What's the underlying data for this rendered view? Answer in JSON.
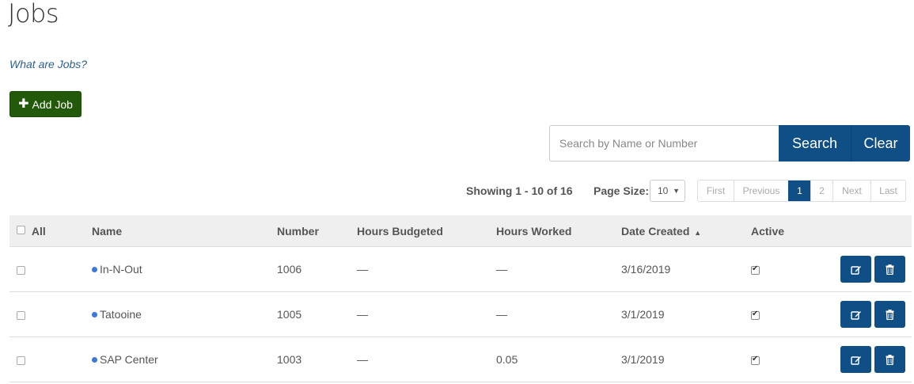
{
  "page": {
    "title": "Jobs",
    "help_link": "What are Jobs?"
  },
  "toolbar": {
    "add_label": "Add Job"
  },
  "search": {
    "placeholder": "Search by Name or Number",
    "value": "",
    "search_label": "Search",
    "clear_label": "Clear"
  },
  "paging": {
    "showing": "Showing 1 - 10 of 16",
    "page_size_label": "Page Size:",
    "page_size": "10",
    "first": "First",
    "previous": "Previous",
    "page_1": "1",
    "page_2": "2",
    "next": "Next",
    "last": "Last",
    "current_page": 1
  },
  "table": {
    "headers": {
      "all": "All",
      "name": "Name",
      "number": "Number",
      "hours_budgeted": "Hours Budgeted",
      "hours_worked": "Hours Worked",
      "date_created": "Date Created",
      "active": "Active"
    },
    "sort": {
      "column": "Date Created",
      "direction": "ascending"
    },
    "rows": [
      {
        "name": "In-N-Out",
        "number": "1006",
        "hours_budgeted": "—",
        "hours_worked": "—",
        "date_created": "3/16/2019",
        "active": true
      },
      {
        "name": "Tatooine",
        "number": "1005",
        "hours_budgeted": "—",
        "hours_worked": "—",
        "date_created": "3/1/2019",
        "active": true
      },
      {
        "name": "SAP Center",
        "number": "1003",
        "hours_budgeted": "—",
        "hours_worked": "0.05",
        "date_created": "3/1/2019",
        "active": true
      }
    ]
  },
  "colors": {
    "add_button": "#22590a",
    "primary": "#0f4f85",
    "status_dot": "#3c78d8",
    "header_bg": "#efefef",
    "link": "#2f5f8a"
  },
  "icons": {
    "add": "plus-icon",
    "edit": "edit-icon",
    "delete": "trash-icon",
    "sort": "sort-up-icon",
    "select": "chevron-down-icon"
  }
}
